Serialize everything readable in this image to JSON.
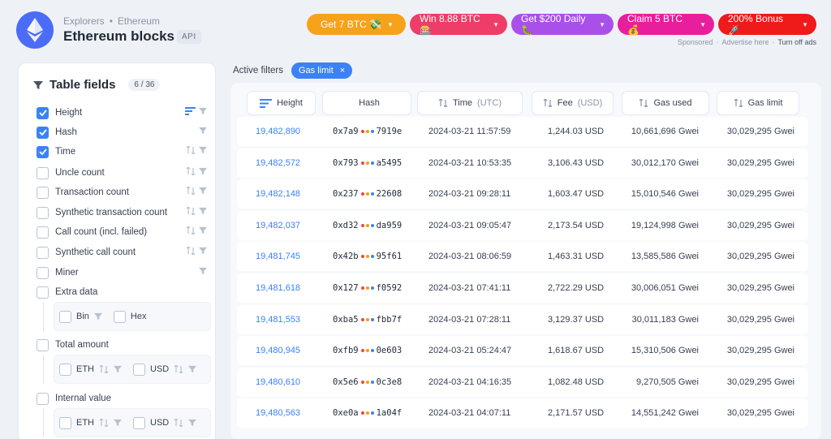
{
  "header": {
    "breadcrumbs": [
      "Explorers",
      "Ethereum"
    ],
    "crumb_sep": "•",
    "title": "Ethereum blocks",
    "api_badge": "API"
  },
  "ads": [
    {
      "label": "Get 7 BTC 💸",
      "color": "#f7a21b"
    },
    {
      "label": "Win 8.88 BTC 🎰",
      "color": "#ee3d68"
    },
    {
      "label": "Get $200 Daily 🐛",
      "color": "#a950ea"
    },
    {
      "label": "Claim 5 BTC 💰",
      "color": "#e91e9c"
    },
    {
      "label": "200% Bonus 🚀",
      "color": "#ef1a1a"
    }
  ],
  "sponsor": {
    "sponsored": "Sponsored",
    "sep": "·",
    "advertise": "Advertise here",
    "turnoff": "Turn off ads"
  },
  "sidebar": {
    "title": "Table fields",
    "count": "6 / 36",
    "fields": [
      {
        "label": "Height",
        "checked": true,
        "sort": "active",
        "filter": true
      },
      {
        "label": "Hash",
        "checked": true,
        "sort": "none",
        "filter": true
      },
      {
        "label": "Time",
        "checked": true,
        "sort": "sortable",
        "filter": true
      },
      {
        "label": "Uncle count",
        "checked": false,
        "sort": "sortable",
        "filter": true
      },
      {
        "label": "Transaction count",
        "checked": false,
        "sort": "sortable",
        "filter": true
      },
      {
        "label": "Synthetic transaction count",
        "checked": false,
        "sort": "sortable",
        "filter": true
      },
      {
        "label": "Call count (incl. failed)",
        "checked": false,
        "sort": "sortable",
        "filter": true
      },
      {
        "label": "Synthetic call count",
        "checked": false,
        "sort": "sortable",
        "filter": true
      },
      {
        "label": "Miner",
        "checked": false,
        "sort": "none",
        "filter": true
      },
      {
        "label": "Extra data",
        "checked": false,
        "sort": "none",
        "filter": false
      }
    ],
    "extra_sub": [
      {
        "label": "Bin",
        "sort": false,
        "filter": true
      },
      {
        "label": "Hex",
        "sort": false,
        "filter": false
      }
    ],
    "total_amount": {
      "label": "Total amount",
      "sub": [
        {
          "label": "ETH"
        },
        {
          "label": "USD"
        }
      ]
    },
    "internal_value": {
      "label": "Internal value",
      "sub": [
        {
          "label": "ETH"
        },
        {
          "label": "USD"
        }
      ]
    }
  },
  "filters": {
    "label": "Active filters",
    "chip": "Gas limit",
    "chip_x": "×"
  },
  "table": {
    "columns": [
      {
        "label": "Height",
        "unit": ""
      },
      {
        "label": "Hash",
        "unit": ""
      },
      {
        "label": "Time",
        "unit": "(UTC)"
      },
      {
        "label": "Fee",
        "unit": "(USD)"
      },
      {
        "label": "Gas used",
        "unit": ""
      },
      {
        "label": "Gas limit",
        "unit": ""
      }
    ],
    "rows": [
      {
        "height": "19,482,890",
        "hash_a": "0x7a9",
        "hash_b": "7919e",
        "time": "2024-03-21 11:57:59",
        "fee": "1,244.03 USD",
        "gas_used": "10,661,696 Gwei",
        "gas_limit": "30,029,295 Gwei"
      },
      {
        "height": "19,482,572",
        "hash_a": "0x793",
        "hash_b": "a5495",
        "time": "2024-03-21 10:53:35",
        "fee": "3,106.43 USD",
        "gas_used": "30,012,170 Gwei",
        "gas_limit": "30,029,295 Gwei"
      },
      {
        "height": "19,482,148",
        "hash_a": "0x237",
        "hash_b": "22608",
        "time": "2024-03-21 09:28:11",
        "fee": "1,603.47 USD",
        "gas_used": "15,010,546 Gwei",
        "gas_limit": "30,029,295 Gwei"
      },
      {
        "height": "19,482,037",
        "hash_a": "0xd32",
        "hash_b": "da959",
        "time": "2024-03-21 09:05:47",
        "fee": "2,173.54 USD",
        "gas_used": "19,124,998 Gwei",
        "gas_limit": "30,029,295 Gwei"
      },
      {
        "height": "19,481,745",
        "hash_a": "0x42b",
        "hash_b": "95f61",
        "time": "2024-03-21 08:06:59",
        "fee": "1,463.31 USD",
        "gas_used": "13,585,586 Gwei",
        "gas_limit": "30,029,295 Gwei"
      },
      {
        "height": "19,481,618",
        "hash_a": "0x127",
        "hash_b": "f0592",
        "time": "2024-03-21 07:41:11",
        "fee": "2,722.29 USD",
        "gas_used": "30,006,051 Gwei",
        "gas_limit": "30,029,295 Gwei"
      },
      {
        "height": "19,481,553",
        "hash_a": "0xba5",
        "hash_b": "fbb7f",
        "time": "2024-03-21 07:28:11",
        "fee": "3,129.37 USD",
        "gas_used": "30,011,183 Gwei",
        "gas_limit": "30,029,295 Gwei"
      },
      {
        "height": "19,480,945",
        "hash_a": "0xfb9",
        "hash_b": "0e603",
        "time": "2024-03-21 05:24:47",
        "fee": "1,618.67 USD",
        "gas_used": "15,310,506 Gwei",
        "gas_limit": "30,029,295 Gwei"
      },
      {
        "height": "19,480,610",
        "hash_a": "0x5e6",
        "hash_b": "0c3e8",
        "time": "2024-03-21 04:16:35",
        "fee": "1,082.48 USD",
        "gas_used": "9,270,505 Gwei",
        "gas_limit": "30,029,295 Gwei"
      },
      {
        "height": "19,480,563",
        "hash_a": "0xe0a",
        "hash_b": "1a04f",
        "time": "2024-03-21 04:07:11",
        "fee": "2,171.57 USD",
        "gas_used": "14,551,242 Gwei",
        "gas_limit": "30,029,295 Gwei"
      }
    ]
  },
  "colors": {
    "accent": "#3b82f6",
    "hash_dots": [
      "#ef4444",
      "#f59e0b",
      "#3b82f6"
    ]
  }
}
